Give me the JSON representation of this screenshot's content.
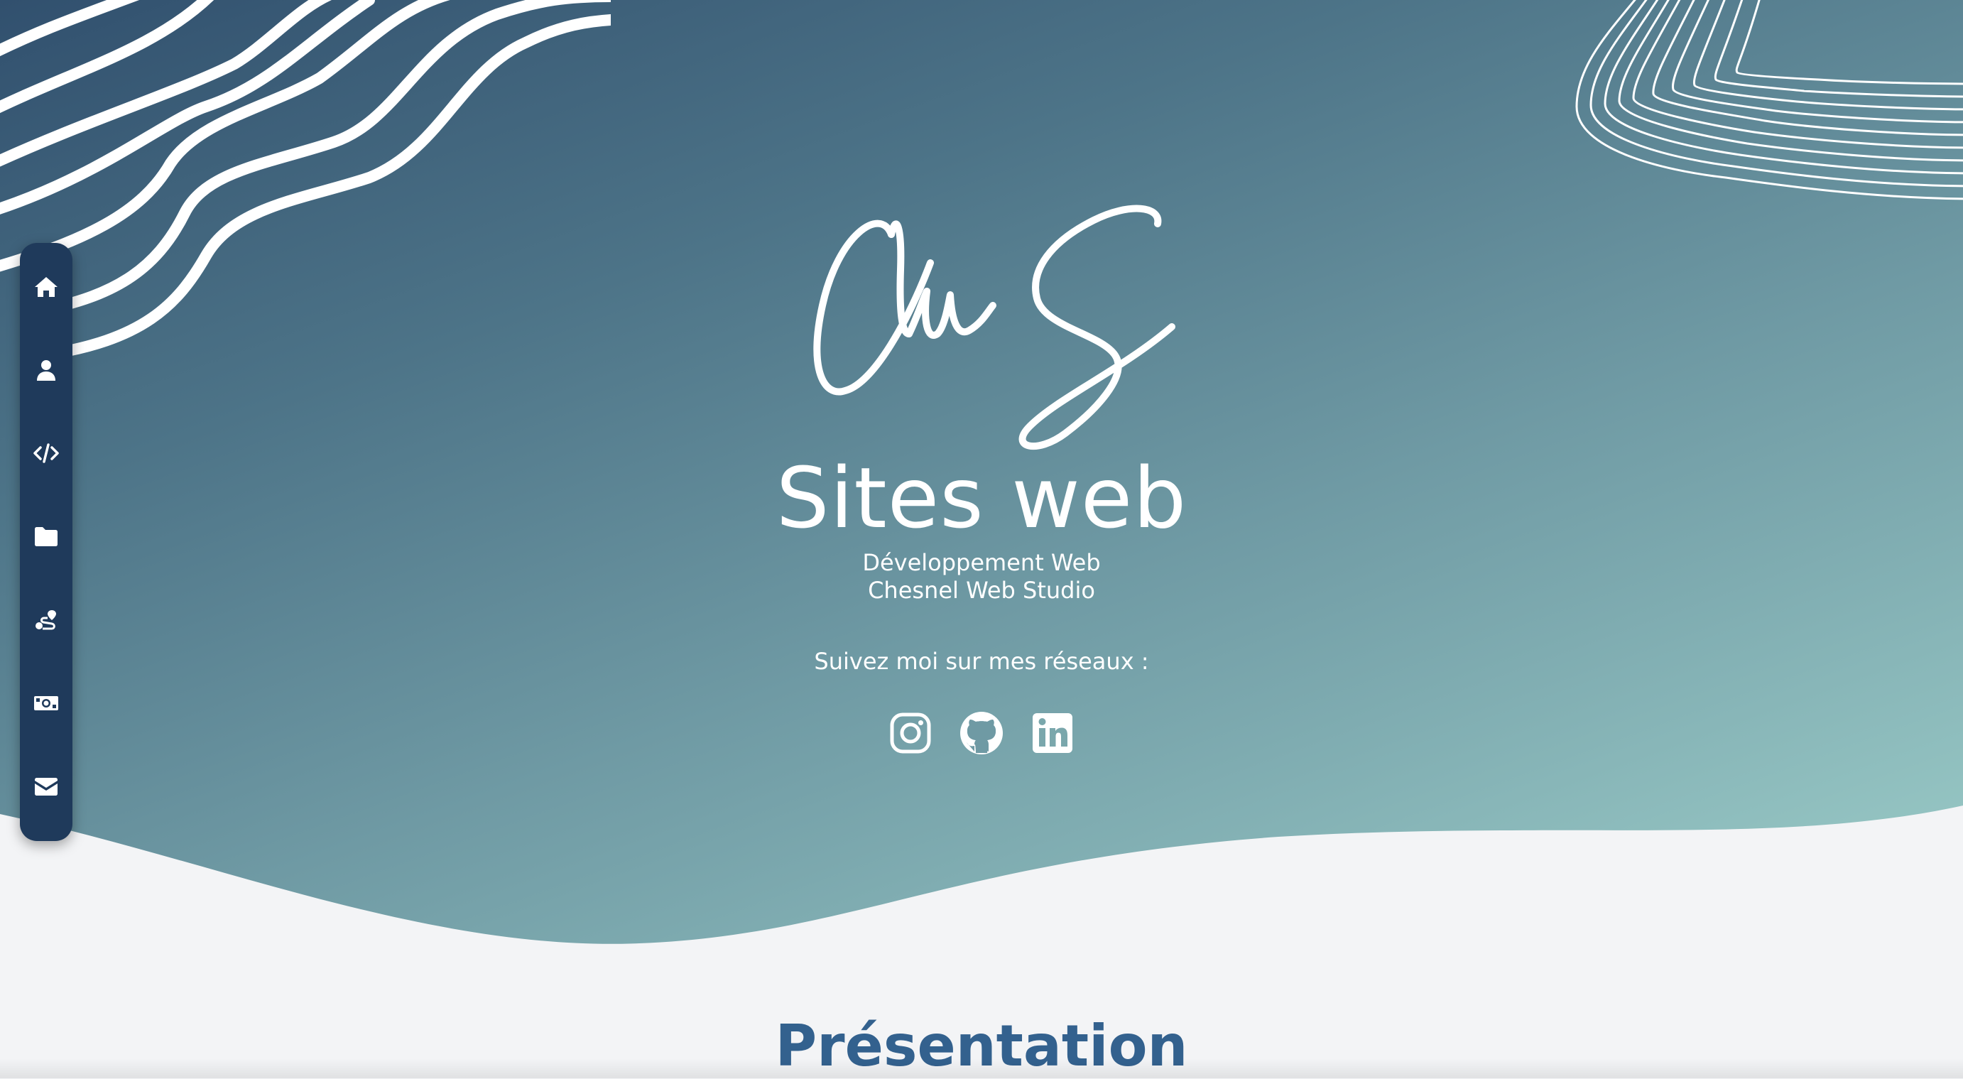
{
  "hero": {
    "brand": "Sites web",
    "subtitle_line1": "Développement Web",
    "subtitle_line2": "Chesnel Web Studio",
    "follow_text": "Suivez moi sur mes réseaux :",
    "logo_text": "CwS"
  },
  "sidebar": {
    "items": [
      {
        "icon": "home-icon"
      },
      {
        "icon": "user-icon"
      },
      {
        "icon": "code-icon"
      },
      {
        "icon": "folder-icon"
      },
      {
        "icon": "route-icon"
      },
      {
        "icon": "money-icon"
      },
      {
        "icon": "envelope-icon"
      }
    ]
  },
  "socials": [
    {
      "icon": "instagram-icon"
    },
    {
      "icon": "github-icon"
    },
    {
      "icon": "linkedin-icon"
    }
  ],
  "section": {
    "title": "Présentation"
  },
  "colors": {
    "sidebar_bg": "#1f3a5b",
    "gradient_start": "#31506e",
    "gradient_end": "#9ecfca",
    "section_title": "#33618e",
    "page_bg": "#f3f4f6"
  }
}
